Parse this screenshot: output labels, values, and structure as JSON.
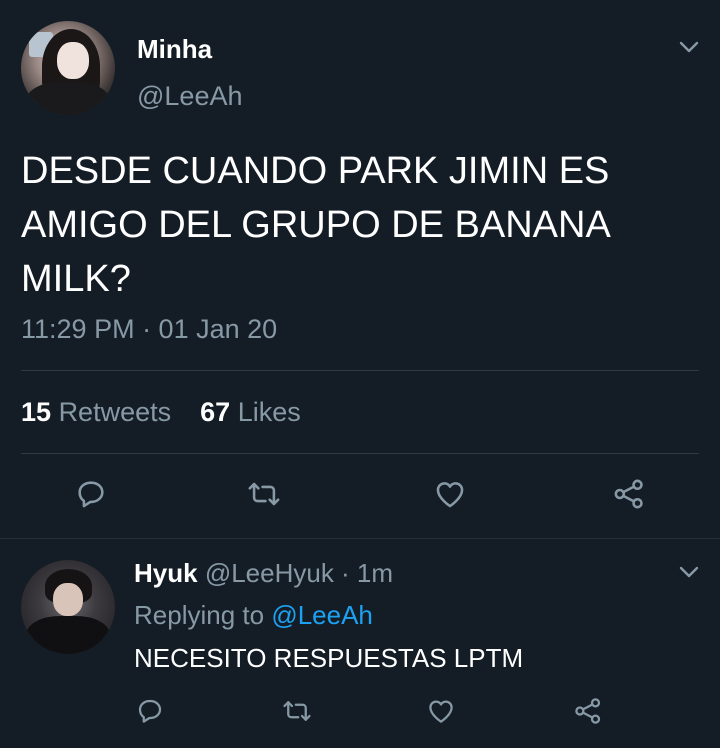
{
  "tweet": {
    "display_name": "Minha",
    "handle": "@LeeAh",
    "text": "DESDE CUANDO PARK JIMIN ES AMIGO DEL GRUPO DE BANANA MILK?",
    "timestamp": "11:29 PM · 01 Jan 20",
    "retweet_count": "15",
    "retweet_label": "Retweets",
    "like_count": "67",
    "like_label": "Likes"
  },
  "reply": {
    "display_name": "Hyuk",
    "handle_time": "@LeeHyuk · 1m",
    "replying_prefix": "Replying to",
    "replying_handle": "@LeeAh",
    "text": "NECESITO RESPUESTAS LPTM"
  },
  "icons": {
    "reply": "reply-icon",
    "retweet": "retweet-icon",
    "like": "heart-icon",
    "share": "share-icon",
    "menu": "chevron-down-icon"
  },
  "colors": {
    "background": "#141d26",
    "text": "#ffffff",
    "muted": "#8899a6",
    "link": "#1da1f2",
    "divider": "#2f3a45"
  }
}
